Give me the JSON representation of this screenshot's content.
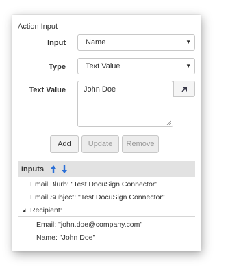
{
  "section_title": "Action Input",
  "form": {
    "input_label": "Input",
    "input_value": "Name",
    "type_label": "Type",
    "type_value": "Text Value",
    "text_value_label": "Text Value",
    "text_value": "John Doe"
  },
  "buttons": {
    "add": "Add",
    "update": "Update",
    "remove": "Remove"
  },
  "inputs_list": {
    "title": "Inputs",
    "rows": [
      "Email Blurb: \"Test DocuSign Connector\"",
      "Email Subject: \"Test DocuSign Connector\"",
      "Recipient:",
      "Email: \"john.doe@company.com\"",
      "Name: \"John Doe\""
    ]
  },
  "colors": {
    "arrow_blue": "#2a6fd6",
    "header_bg": "#e2e2e2"
  },
  "icons": [
    "chevron-down-icon",
    "pick-field-icon",
    "resize-handle-icon",
    "move-up-icon",
    "move-down-icon",
    "collapse-triangle-icon"
  ]
}
